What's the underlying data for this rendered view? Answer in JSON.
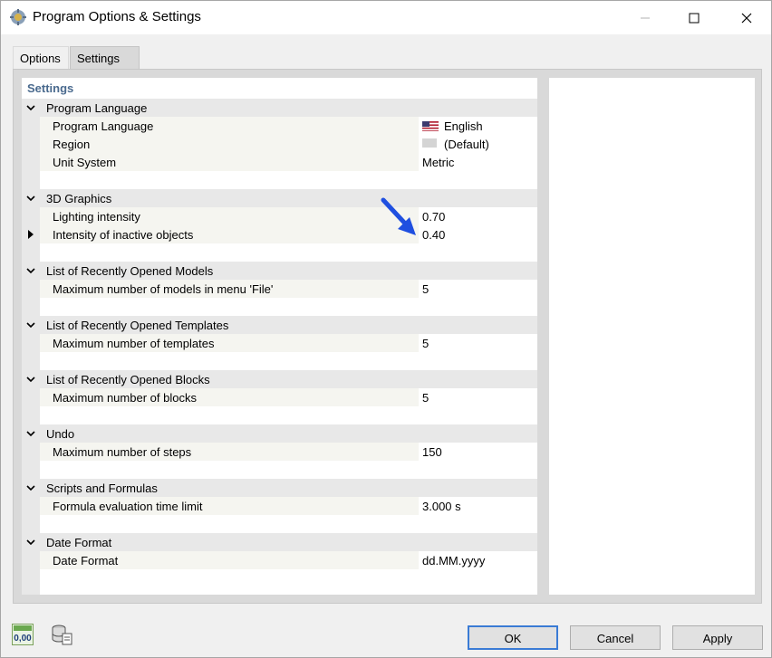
{
  "window": {
    "title": "Program Options & Settings",
    "icons": {
      "app": "gear-cube-icon",
      "minimize": "minimize-icon",
      "maximize": "maximize-icon",
      "close": "close-icon"
    }
  },
  "tabs": [
    {
      "label": "Options",
      "active": false
    },
    {
      "label": "Settings",
      "active": true
    }
  ],
  "grid": {
    "header": "Settings",
    "categories": [
      {
        "label": "Program Language",
        "items": [
          {
            "name": "Program Language",
            "value": "English",
            "icon": "us-flag-icon"
          },
          {
            "name": "Region",
            "value": "(Default)",
            "icon": "blank-region-icon"
          },
          {
            "name": "Unit System",
            "value": "Metric"
          }
        ]
      },
      {
        "label": "3D Graphics",
        "items": [
          {
            "name": "Lighting intensity",
            "value": "0.70"
          },
          {
            "name": "Intensity of inactive objects",
            "value": "0.40",
            "selected": true
          }
        ]
      },
      {
        "label": "List of Recently Opened Models",
        "items": [
          {
            "name": "Maximum number of models in menu 'File'",
            "value": "5"
          }
        ]
      },
      {
        "label": "List of Recently Opened Templates",
        "items": [
          {
            "name": "Maximum number of templates",
            "value": "5"
          }
        ]
      },
      {
        "label": "List of Recently Opened Blocks",
        "items": [
          {
            "name": "Maximum number of blocks",
            "value": "5"
          }
        ]
      },
      {
        "label": "Undo",
        "items": [
          {
            "name": "Maximum number of steps",
            "value": "150"
          }
        ]
      },
      {
        "label": "Scripts and Formulas",
        "items": [
          {
            "name": "Formula evaluation time limit",
            "value": "3.000 s"
          }
        ]
      },
      {
        "label": "Date Format",
        "items": [
          {
            "name": "Date Format",
            "value": "dd.MM.yyyy"
          }
        ]
      }
    ]
  },
  "annotation": {
    "icon": "blue-arrow-icon",
    "color": "#1f4fe0"
  },
  "footer": {
    "units_icon_text": "0,00",
    "icons": [
      "units-icon",
      "database-icon"
    ],
    "ok": "OK",
    "cancel": "Cancel",
    "apply": "Apply"
  }
}
